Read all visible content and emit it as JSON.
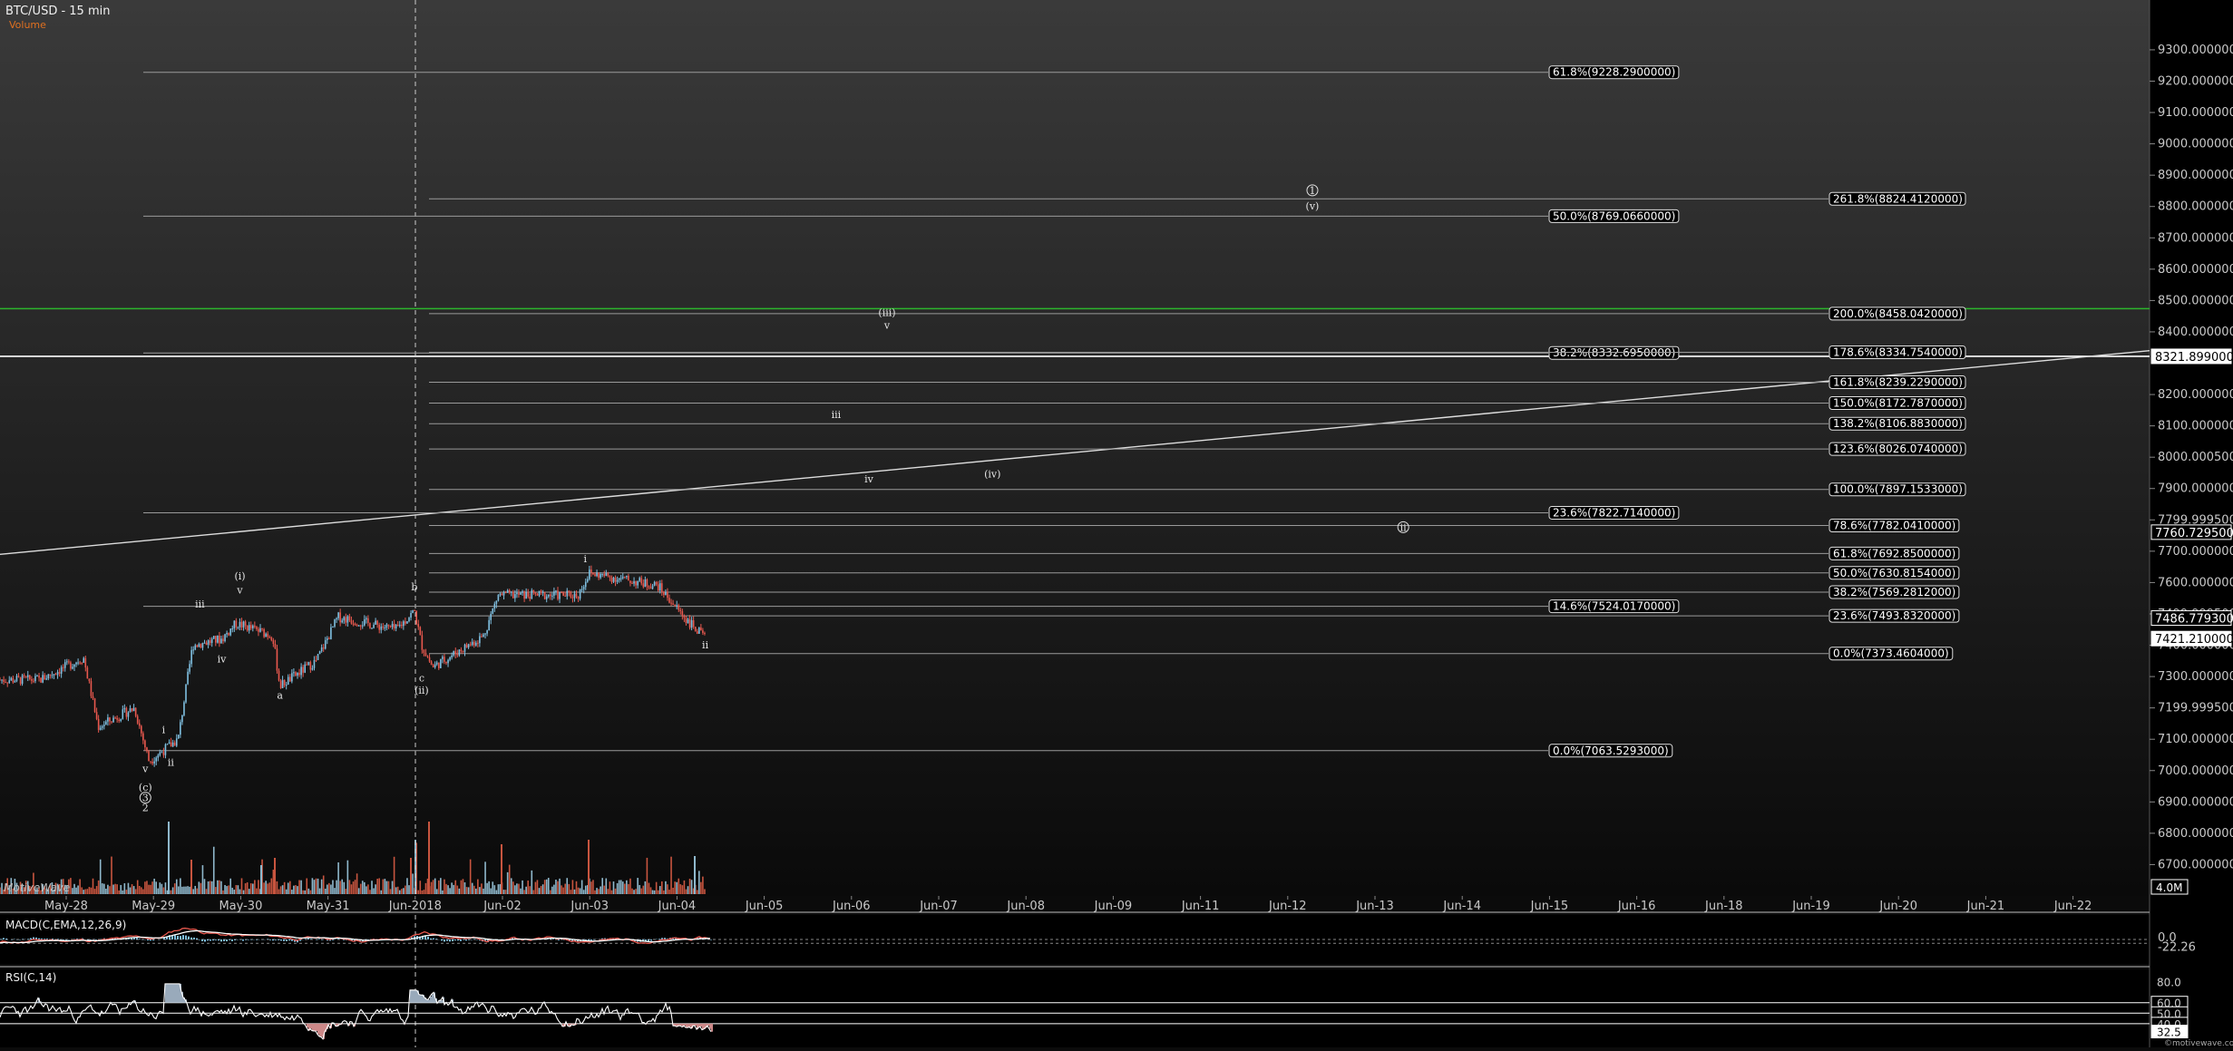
{
  "header": {
    "title": "BTC/USD - 15 min",
    "subtitle": "Volume"
  },
  "watermark": "MotiveWave",
  "credit": "©motivewave.com",
  "colors": {
    "bg_top": "#3a3a3a",
    "bg_bottom": "#0a0a0a",
    "green": "#2db52d",
    "up": "#7fbfe0",
    "down": "#e8584e",
    "volume": "#c8553f"
  },
  "chart_data": [
    {
      "type": "candlestick",
      "title": "BTC/USD - 15 min",
      "ylim": [
        6600,
        9430
      ],
      "y_ticks": [
        {
          "v": 6700,
          "label": "6700.0000000"
        },
        {
          "v": 6800,
          "label": "6800.0000000"
        },
        {
          "v": 6900,
          "label": "6900.0000000"
        },
        {
          "v": 7000,
          "label": "7000.0000000"
        },
        {
          "v": 7100,
          "label": "7100.0000000"
        },
        {
          "v": 7200,
          "label": "7199.9995000"
        },
        {
          "v": 7300,
          "label": "7300.0000000"
        },
        {
          "v": 7400,
          "label": "7400.0000000"
        },
        {
          "v": 7500,
          "label": "7499.9995000"
        },
        {
          "v": 7600,
          "label": "7600.0000000"
        },
        {
          "v": 7700,
          "label": "7700.0000000"
        },
        {
          "v": 7800,
          "label": "7799.9995000"
        },
        {
          "v": 7900,
          "label": "7900.0000000"
        },
        {
          "v": 8000,
          "label": "8000.0005000"
        },
        {
          "v": 8100,
          "label": "8100.0000000"
        },
        {
          "v": 8200,
          "label": "8200.0000000"
        },
        {
          "v": 8400,
          "label": "8400.0000000"
        },
        {
          "v": 8500,
          "label": "8500.0000000"
        },
        {
          "v": 8600,
          "label": "8600.0000000"
        },
        {
          "v": 8700,
          "label": "8700.0000000"
        },
        {
          "v": 8800,
          "label": "8800.0000000"
        },
        {
          "v": 8900,
          "label": "8900.0000000"
        },
        {
          "v": 9000,
          "label": "9000.0000000"
        },
        {
          "v": 9100,
          "label": "9100.0000000"
        },
        {
          "v": 9200,
          "label": "9200.0000000"
        },
        {
          "v": 9300,
          "label": "9300.0000000"
        }
      ],
      "x_ticks": [
        "May-28",
        "May-29",
        "May-30",
        "May-31",
        "Jun-2018",
        "Jun-02",
        "Jun-03",
        "Jun-04",
        "Jun-05",
        "Jun-06",
        "Jun-07",
        "Jun-08",
        "Jun-09",
        "Jun-11",
        "Jun-12",
        "Jun-13",
        "Jun-14",
        "Jun-15",
        "Jun-16",
        "Jun-18",
        "Jun-19",
        "Jun-20",
        "Jun-21",
        "Jun-22"
      ],
      "price_path": [
        [
          "May-27 18:00",
          7290
        ],
        [
          "May-28 06:00",
          7360
        ],
        [
          "May-28 10:00",
          7140
        ],
        [
          "May-28 20:00",
          7200
        ],
        [
          "May-29 00:00",
          7030
        ],
        [
          "May-29 08:00",
          7100
        ],
        [
          "May-29 12:00",
          7400
        ],
        [
          "May-29 20:00",
          7420
        ],
        [
          "May-30 00:00",
          7470
        ],
        [
          "May-30 10:00",
          7430
        ],
        [
          "May-30 12:00",
          7270
        ],
        [
          "May-30 22:00",
          7350
        ],
        [
          "May-31 04:00",
          7490
        ],
        [
          "May-31 20:00",
          7450
        ],
        [
          "Jun-01 01:00",
          7510
        ],
        [
          "Jun-01 03:00",
          7400
        ],
        [
          "Jun-01 06:00",
          7330
        ],
        [
          "Jun-01 20:00",
          7430
        ],
        [
          "Jun-02 00:00",
          7560
        ],
        [
          "Jun-02 22:00",
          7560
        ],
        [
          "Jun-03 01:00",
          7630
        ],
        [
          "Jun-03 20:00",
          7590
        ],
        [
          "Jun-04 04:00",
          7480
        ],
        [
          "Jun-04 09:00",
          7421
        ]
      ],
      "current_price": "7421.2100000",
      "price_markers": [
        {
          "v": 8321.899,
          "label": "8321.8990000",
          "style": "white"
        },
        {
          "v": 7760.7295,
          "label": "7760.7295000",
          "style": "outline"
        },
        {
          "v": 7486.7793,
          "label": "7486.7793000",
          "style": "outline"
        },
        {
          "v": 7421.21,
          "label": "7421.2100000",
          "style": "white"
        }
      ],
      "volume_label": "4.0M",
      "fib_retracements": [
        {
          "label": "61.8%(9228.2900000)",
          "v": 9228.29
        },
        {
          "label": "50.0%(8769.0660000)",
          "v": 8769.066
        },
        {
          "label": "38.2%(8332.6950000)",
          "v": 8332.695
        },
        {
          "label": "23.6%(7822.7140000)",
          "v": 7822.714
        },
        {
          "label": "14.6%(7524.0170000)",
          "v": 7524.017
        },
        {
          "label": "0.0%(7063.5293000)",
          "v": 7063.5293
        }
      ],
      "fib_extensions": [
        {
          "label": "261.8%(8824.4120000)",
          "v": 8824.412
        },
        {
          "label": "200.0%(8458.0420000)",
          "v": 8458.042
        },
        {
          "label": "178.6%(8334.7540000)",
          "v": 8334.754
        },
        {
          "label": "161.8%(8239.2290000)",
          "v": 8239.229
        },
        {
          "label": "150.0%(8172.7870000)",
          "v": 8172.787
        },
        {
          "label": "138.2%(8106.8830000)",
          "v": 8106.883
        },
        {
          "label": "123.6%(8026.0740000)",
          "v": 8026.074
        },
        {
          "label": "100.0%(7897.1533000)",
          "v": 7897.1533
        },
        {
          "label": "78.6%(7782.0410000)",
          "v": 7782.041
        },
        {
          "label": "61.8%(7692.8500000)",
          "v": 7692.85
        },
        {
          "label": "50.0%(7630.8154000)",
          "v": 7630.8154
        },
        {
          "label": "38.2%(7569.2812000)",
          "v": 7569.2812
        },
        {
          "label": "23.6%(7493.8320000)",
          "v": 7493.832
        },
        {
          "label": "0.0%(7373.4604000)",
          "v": 7373.4604
        }
      ],
      "horizontal_lines": [
        {
          "v": 8474,
          "color": "#2db52d"
        },
        {
          "v": 8321.899,
          "color": "#ffffff"
        }
      ],
      "trendline": [
        [
          "May-27 18:00",
          7690
        ],
        [
          "Jun-22 18:00",
          8340
        ]
      ],
      "wave_labels": [
        {
          "text": "i",
          "t": "May-29 04:00",
          "v": 7120
        },
        {
          "text": "ii",
          "t": "May-29 06:00",
          "v": 7015
        },
        {
          "text": "v",
          "t": "May-28 23:00",
          "v": 6995
        },
        {
          "text": "(c)",
          "t": "May-28 23:00",
          "v": 6935
        },
        {
          "text": "2",
          "t": "May-28 23:00",
          "v": 6870
        },
        {
          "text": "iii",
          "t": "May-29 14:00",
          "v": 7520
        },
        {
          "text": "iv",
          "t": "May-29 20:00",
          "v": 7345
        },
        {
          "text": "v",
          "t": "May-30 01:00",
          "v": 7565
        },
        {
          "text": "(i)",
          "t": "May-30 01:00",
          "v": 7610
        },
        {
          "text": "a",
          "t": "May-30 12:00",
          "v": 7230
        },
        {
          "text": "b",
          "t": "Jun-01 01:00",
          "v": 7575
        },
        {
          "text": "c",
          "t": "Jun-01 03:00",
          "v": 7285
        },
        {
          "text": "(ii)",
          "t": "Jun-01 03:00",
          "v": 7245
        },
        {
          "text": "i",
          "t": "Jun-03 00:00",
          "v": 7665
        },
        {
          "text": "ii",
          "t": "Jun-04 09:00",
          "v": 7390
        },
        {
          "text": "iii",
          "t": "Jun-05 21:00",
          "v": 8125
        },
        {
          "text": "iv",
          "t": "Jun-06 06:00",
          "v": 7920
        },
        {
          "text": "(iii)",
          "t": "Jun-06 11:00",
          "v": 8450
        },
        {
          "text": "v",
          "t": "Jun-06 11:00",
          "v": 8410
        },
        {
          "text": "(iv)",
          "t": "Jun-07 16:00",
          "v": 7935
        },
        {
          "text": "(v)",
          "t": "Jun-11 08:00",
          "v": 8790
        },
        {
          "text": "1",
          "t": "Jun-11 08:00",
          "v": 8840,
          "circled": true
        },
        {
          "text": "ii",
          "t": "Jun-12 09:00",
          "v": 7765,
          "circled": true
        },
        {
          "text": "3",
          "t": "May-28 23:00",
          "v": 6902,
          "circled": true
        }
      ],
      "vertical_marker": "Jun-01 00:00"
    },
    {
      "type": "line",
      "title": "MACD(C,EMA,12,26,9)",
      "series": [
        {
          "name": "MACD",
          "color": "#e8584e"
        },
        {
          "name": "Signal",
          "color": "#ffffff"
        },
        {
          "name": "Histogram",
          "color": "#7fbfe0"
        }
      ],
      "ylim": [
        -130,
        130
      ],
      "y_labels": [
        "0.0",
        "-22.26"
      ],
      "ref_levels": [
        0,
        -22.26
      ]
    },
    {
      "type": "line",
      "title": "RSI(C,14)",
      "series": [
        {
          "name": "RSI",
          "color": "#ffffff"
        }
      ],
      "ylim": [
        20,
        90
      ],
      "y_labels": [
        "80.0",
        "60.0",
        "50.0",
        "40.0",
        "32.5"
      ],
      "ref_levels": [
        60,
        50,
        40
      ],
      "current": "32.5"
    }
  ]
}
